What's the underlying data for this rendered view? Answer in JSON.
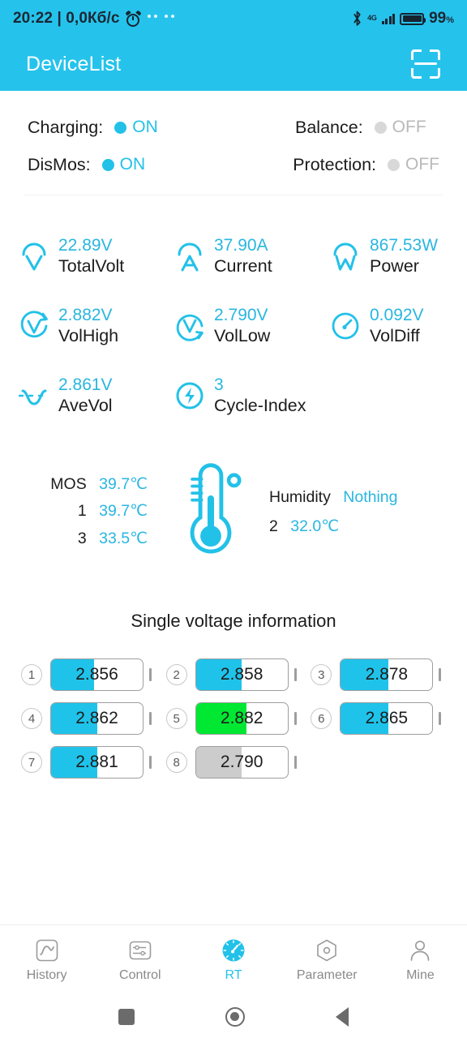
{
  "statusbar": {
    "time_text": "20:22 | 0,0Кб/с",
    "alarm_icon": "alarm-clock-icon",
    "app_icon_1": "app-notification-icon",
    "app_icon_2": "app-notification-icon",
    "bluetooth_icon": "bluetooth-icon",
    "network_label": "4G",
    "signal_icon": "signal-bars-icon",
    "battery_icon": "battery-full-icon",
    "battery_percent": "99",
    "battery_percent_symbol": "%"
  },
  "appbar": {
    "title": "DeviceList",
    "scan_icon": "scan-icon"
  },
  "toggles": [
    {
      "label": "Charging:",
      "value": "ON",
      "state": "on"
    },
    {
      "label": "Balance:",
      "value": "OFF",
      "state": "off"
    },
    {
      "label": "DisMos:",
      "value": "ON",
      "state": "on"
    },
    {
      "label": "Protection:",
      "value": "OFF",
      "state": "off"
    }
  ],
  "metrics": [
    {
      "icon": "volt-meter-icon",
      "value": "22.89V",
      "name": "TotalVolt"
    },
    {
      "icon": "ampere-meter-icon",
      "value": "37.90A",
      "name": "Current"
    },
    {
      "icon": "watt-meter-icon",
      "value": "867.53W",
      "name": "Power"
    },
    {
      "icon": "volt-high-icon",
      "value": "2.882V",
      "name": "VolHigh"
    },
    {
      "icon": "volt-low-icon",
      "value": "2.790V",
      "name": "VolLow"
    },
    {
      "icon": "gauge-icon",
      "value": "0.092V",
      "name": "VolDiff"
    },
    {
      "icon": "waveform-icon",
      "value": "2.861V",
      "name": "AveVol"
    },
    {
      "icon": "cycle-bolt-icon",
      "value": "3",
      "name": "Cycle-Index"
    }
  ],
  "temperature": {
    "thermometer_icon": "thermometer-icon",
    "left": [
      {
        "key": "MOS",
        "value": "39.7℃"
      },
      {
        "key": "1",
        "value": "39.7℃"
      },
      {
        "key": "3",
        "value": "33.5℃"
      }
    ],
    "right": [
      {
        "key": "Humidity",
        "value": "Nothing"
      },
      {
        "key": "2",
        "value": "32.0℃"
      }
    ]
  },
  "single_voltage": {
    "title": "Single voltage information",
    "cells": [
      {
        "index": "1",
        "value": "2.856",
        "fill_pct": 47,
        "color": "#1fc3ea"
      },
      {
        "index": "2",
        "value": "2.858",
        "fill_pct": 50,
        "color": "#1fc3ea"
      },
      {
        "index": "3",
        "value": "2.878",
        "fill_pct": 52,
        "color": "#1fc3ea"
      },
      {
        "index": "4",
        "value": "2.862",
        "fill_pct": 50,
        "color": "#1fc3ea"
      },
      {
        "index": "5",
        "value": "2.882",
        "fill_pct": 55,
        "color": "#00e832"
      },
      {
        "index": "6",
        "value": "2.865",
        "fill_pct": 52,
        "color": "#1fc3ea"
      },
      {
        "index": "7",
        "value": "2.881",
        "fill_pct": 50,
        "color": "#1fc3ea"
      },
      {
        "index": "8",
        "value": "2.790",
        "fill_pct": 50,
        "color": "#cccccc"
      }
    ]
  },
  "bottom_nav": [
    {
      "label": "History",
      "icon": "history-chart-icon",
      "active": false
    },
    {
      "label": "Control",
      "icon": "sliders-icon",
      "active": false
    },
    {
      "label": "RT",
      "icon": "gauge-filled-icon",
      "active": true
    },
    {
      "label": "Parameter",
      "icon": "hexagon-icon",
      "active": false
    },
    {
      "label": "Mine",
      "icon": "person-icon",
      "active": false
    }
  ],
  "android_nav": {
    "recents": "square-recents-icon",
    "home": "circle-home-icon",
    "back": "triangle-back-icon"
  },
  "colors": {
    "accent": "#22c1e8",
    "appbar": "#25c3ec",
    "green": "#00e832",
    "gray": "#cccccc"
  }
}
